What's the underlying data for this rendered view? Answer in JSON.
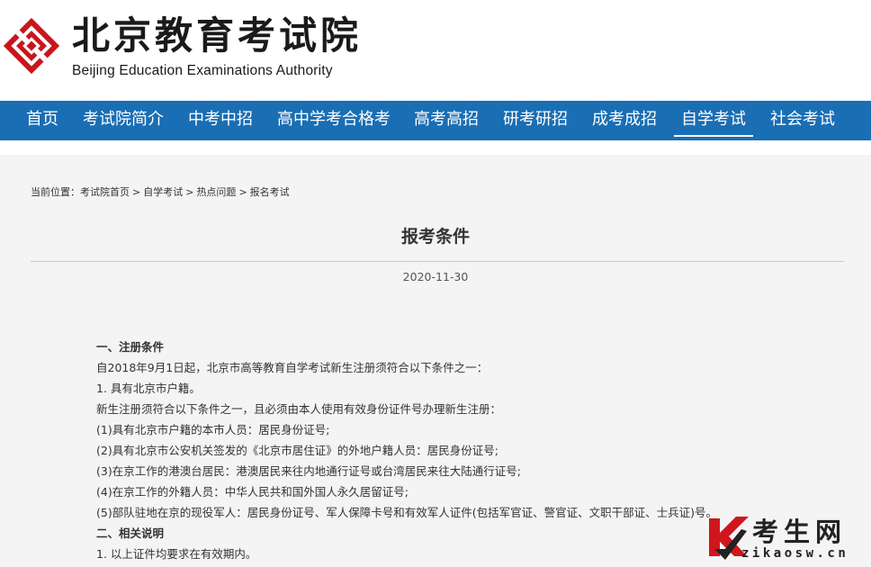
{
  "header": {
    "logo_cn": "北京教育考试院",
    "logo_en": "Beijing Education Examinations Authority",
    "brand_color": "#c8161d"
  },
  "nav": {
    "bg_color": "#1a6eb4",
    "items": [
      {
        "label": "首页"
      },
      {
        "label": "考试院简介"
      },
      {
        "label": "中考中招"
      },
      {
        "label": "高中学考合格考"
      },
      {
        "label": "高考高招"
      },
      {
        "label": "研考研招"
      },
      {
        "label": "成考成招"
      },
      {
        "label": "自学考试",
        "active": true
      },
      {
        "label": "社会考试"
      }
    ]
  },
  "breadcrumb": {
    "prefix": "当前位置：",
    "items": [
      "考试院首页",
      "自学考试",
      "热点问题",
      "报名考试"
    ],
    "separator": ">"
  },
  "article": {
    "title": "报考条件",
    "date": "2020-11-30",
    "paragraphs": [
      {
        "text": "一、注册条件",
        "heading": true
      },
      {
        "text": "自2018年9月1日起，北京市高等教育自学考试新生注册须符合以下条件之一："
      },
      {
        "text": "1. 具有北京市户籍。"
      },
      {
        "text": "新生注册须符合以下条件之一，且必须由本人使用有效身份证件号办理新生注册："
      },
      {
        "text": "(1)具有北京市户籍的本市人员：居民身份证号;"
      },
      {
        "text": "(2)具有北京市公安机关签发的《北京市居住证》的外地户籍人员：居民身份证号;"
      },
      {
        "text": "(3)在京工作的港澳台居民：港澳居民来往内地通行证号或台湾居民来往大陆通行证号;"
      },
      {
        "text": "(4)在京工作的外籍人员：中华人民共和国外国人永久居留证号;"
      },
      {
        "text": "(5)部队驻地在京的现役军人：居民身份证号、军人保障卡号和有效军人证件(包括军官证、警官证、文职干部证、士兵证)号。"
      },
      {
        "text": "二、相关说明",
        "heading": true
      },
      {
        "text": "1. 以上证件均要求在有效期内。"
      }
    ]
  },
  "watermark": {
    "cn": "考生网",
    "en": "zikaosw.cn",
    "accent_color": "#d0161c"
  }
}
